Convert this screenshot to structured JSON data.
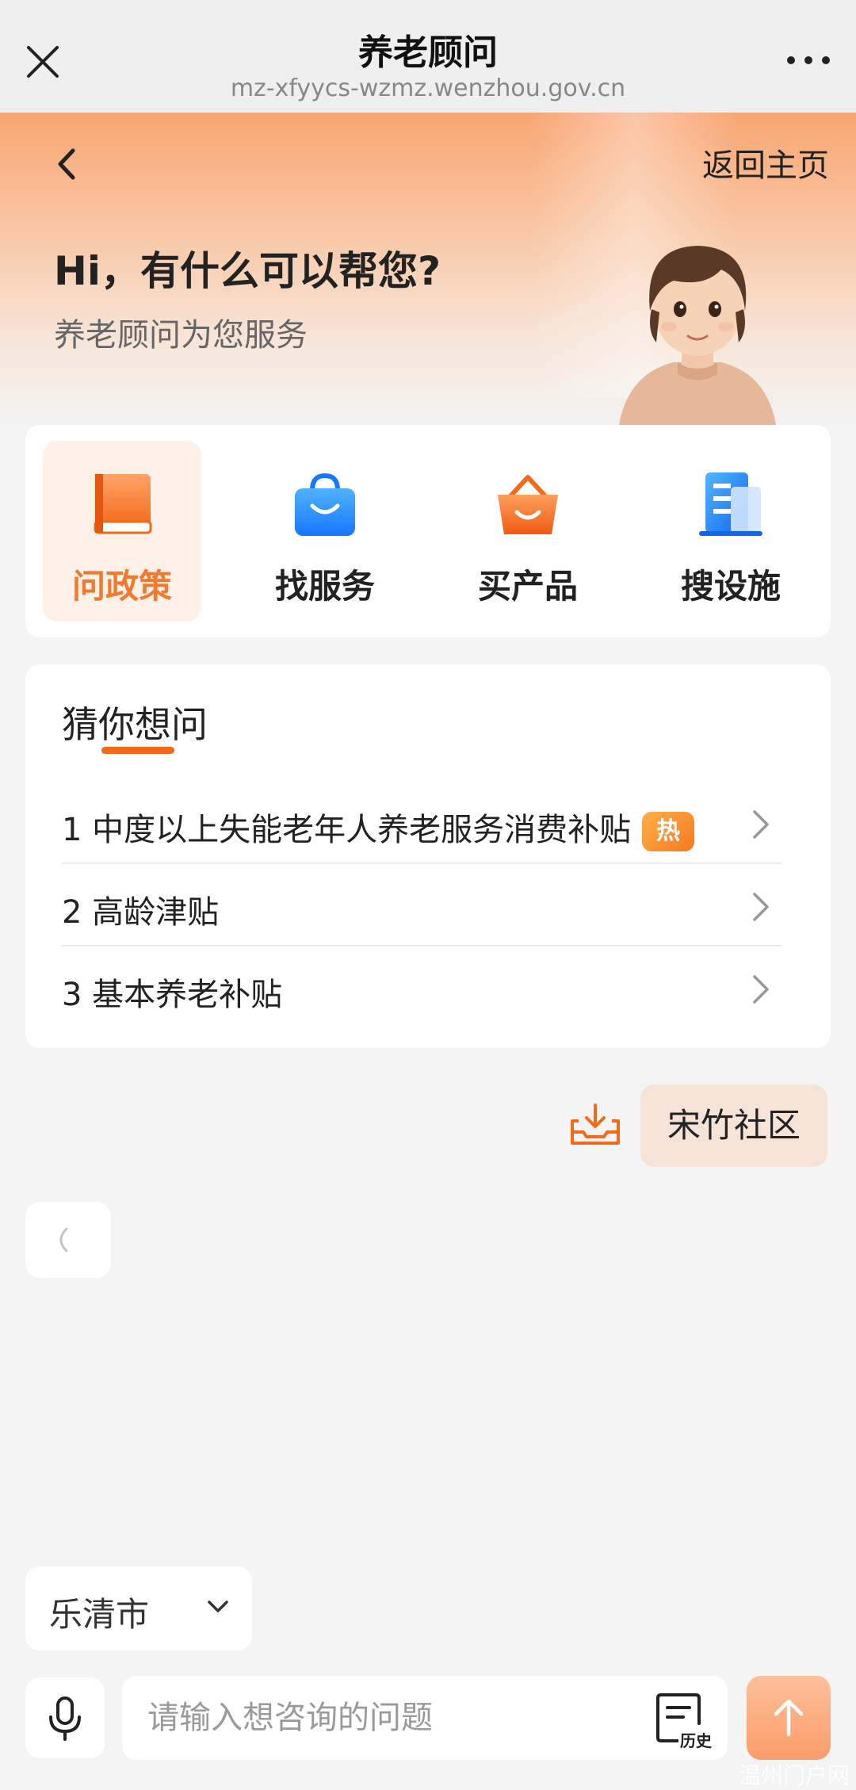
{
  "topbar": {
    "title": "养老顾问",
    "url": "mz-xfyycs-wzmz.wenzhou.gov.cn",
    "close_icon": "close-icon",
    "more_icon": "more-icon"
  },
  "hero": {
    "back_icon": "back-arrow-icon",
    "home_link": "返回主页",
    "greeting": "Hi，有什么可以帮您?",
    "subtitle": "养老顾问为您服务"
  },
  "categories": [
    {
      "label": "问政策",
      "icon": "book-icon",
      "active": true
    },
    {
      "label": "找服务",
      "icon": "bag-icon",
      "active": false
    },
    {
      "label": "买产品",
      "icon": "basket-icon",
      "active": false
    },
    {
      "label": "搜设施",
      "icon": "building-icon",
      "active": false
    }
  ],
  "faq": {
    "title": "猜你想问",
    "items": [
      {
        "text": "1 中度以上失能老年人养老服务消费补贴",
        "badge": "热"
      },
      {
        "text": "2 高龄津贴"
      },
      {
        "text": "3 基本养老补贴"
      }
    ]
  },
  "chat": {
    "user_message": "宋竹社区",
    "download_icon": "download-tray-icon"
  },
  "footer": {
    "city": "乐清市",
    "input_placeholder": "请输入想咨询的问题",
    "history_label": "历史",
    "mic_icon": "microphone-icon",
    "send_icon": "up-arrow-icon"
  },
  "colors": {
    "accent": "#f26a1b",
    "hero_top": "#f8a672",
    "bubble_user": "#f5e3d8"
  },
  "watermark": "温州门户网"
}
